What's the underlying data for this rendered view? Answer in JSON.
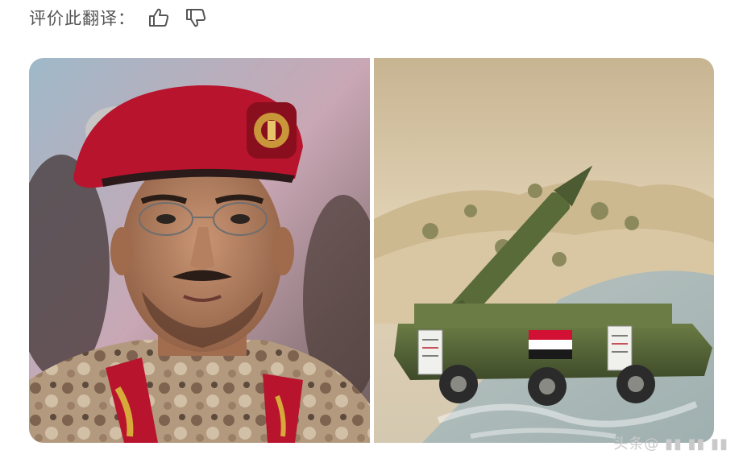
{
  "feedback": {
    "label": "评价此翻译：",
    "like_icon": "thumbs-up-icon",
    "dislike_icon": "thumbs-down-icon"
  },
  "images": {
    "left": {
      "icon": "portrait-officer-photo"
    },
    "right": {
      "icon": "missile-launcher-photo"
    }
  },
  "watermark": {
    "text": "头条@ ▮▮ ▮▮ ▮▮"
  },
  "colors": {
    "beret": "#b8142e",
    "flag_red": "#d21034",
    "sand": "#d9c7a3",
    "vehicle_green": "#5a6b3a"
  }
}
